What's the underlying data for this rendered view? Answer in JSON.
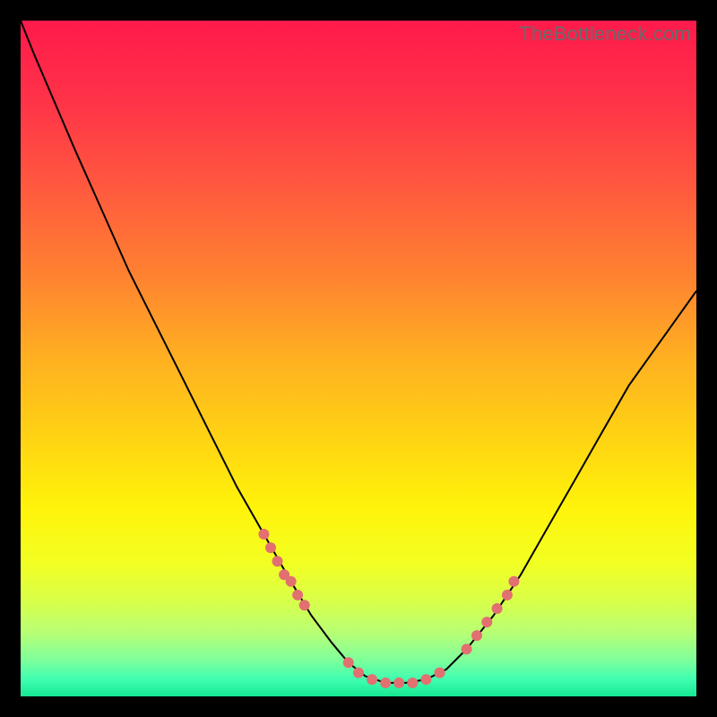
{
  "watermark": "TheBottleneck.com",
  "chart_data": {
    "type": "line",
    "title": "",
    "xlabel": "",
    "ylabel": "",
    "xlim": [
      0,
      100
    ],
    "ylim": [
      0,
      100
    ],
    "grid": false,
    "legend": false,
    "background_gradient": {
      "stops": [
        {
          "offset": 0.0,
          "color": "#ff1a4b"
        },
        {
          "offset": 0.12,
          "color": "#ff3348"
        },
        {
          "offset": 0.25,
          "color": "#ff5a3e"
        },
        {
          "offset": 0.38,
          "color": "#ff8330"
        },
        {
          "offset": 0.5,
          "color": "#ffb021"
        },
        {
          "offset": 0.62,
          "color": "#ffd413"
        },
        {
          "offset": 0.72,
          "color": "#fff30a"
        },
        {
          "offset": 0.8,
          "color": "#f3ff21"
        },
        {
          "offset": 0.86,
          "color": "#d8ff4a"
        },
        {
          "offset": 0.905,
          "color": "#b8ff74"
        },
        {
          "offset": 0.945,
          "color": "#80ff9a"
        },
        {
          "offset": 0.975,
          "color": "#3fffb0"
        },
        {
          "offset": 1.0,
          "color": "#16e792"
        }
      ]
    },
    "series": [
      {
        "name": "bottleneck-curve",
        "color": "#000000",
        "x": [
          0.0,
          2.0,
          5.0,
          8.0,
          12.0,
          16.0,
          20.0,
          24.0,
          28.0,
          32.0,
          36.0,
          40.0,
          43.0,
          46.0,
          48.5,
          51.0,
          54.0,
          57.0,
          60.0,
          63.0,
          66.0,
          70.0,
          74.0,
          78.0,
          82.0,
          86.0,
          90.0,
          95.0,
          100.0
        ],
        "y": [
          100.0,
          95.0,
          88.0,
          81.0,
          72.0,
          63.0,
          55.0,
          47.0,
          39.0,
          31.0,
          24.0,
          17.0,
          12.0,
          8.0,
          5.0,
          3.0,
          2.0,
          2.0,
          2.5,
          4.0,
          7.0,
          12.0,
          18.0,
          25.0,
          32.0,
          39.0,
          46.0,
          53.0,
          60.0
        ]
      }
    ],
    "highlight_points": {
      "color": "#e27070",
      "radius_screen_px": 6,
      "left_cluster": {
        "x": [
          36.0,
          37.0,
          38.0,
          39.0,
          40.0,
          41.0,
          42.0
        ],
        "y": [
          24.0,
          22.0,
          20.0,
          18.0,
          17.0,
          15.0,
          13.5
        ]
      },
      "bottom_cluster": {
        "x": [
          48.5,
          50.0,
          52.0,
          54.0,
          56.0,
          58.0,
          60.0,
          62.0
        ],
        "y": [
          5.0,
          3.5,
          2.5,
          2.0,
          2.0,
          2.0,
          2.5,
          3.5
        ]
      },
      "right_cluster": {
        "x": [
          66.0,
          67.5,
          69.0,
          70.5,
          72.0,
          73.0
        ],
        "y": [
          7.0,
          9.0,
          11.0,
          13.0,
          15.0,
          17.0
        ]
      }
    }
  }
}
